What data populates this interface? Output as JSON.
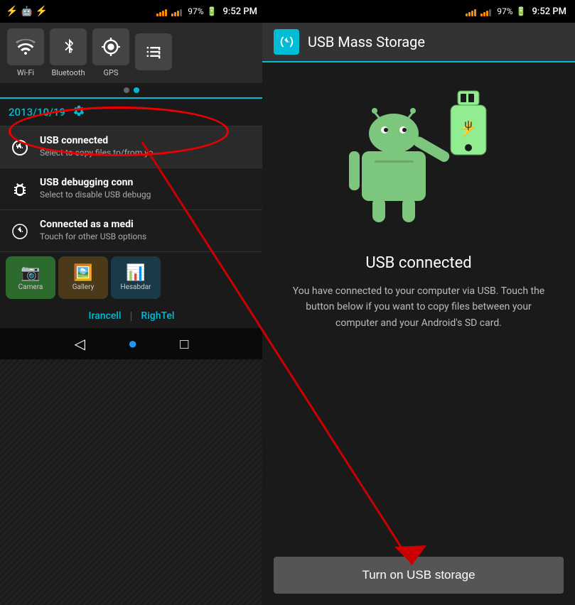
{
  "leftPanel": {
    "statusBar": {
      "usbIcon": "⚡",
      "batteryPercent": "97%",
      "time": "9:52 PM"
    },
    "quickToggles": [
      {
        "label": "Wi-Fi",
        "icon": "wifi",
        "active": false
      },
      {
        "label": "Bluetooth",
        "icon": "bt",
        "active": false
      },
      {
        "label": "GPS",
        "icon": "gps",
        "active": false
      },
      {
        "label": "",
        "icon": "share",
        "active": false
      }
    ],
    "dateText": "2013/10/19",
    "notifications": [
      {
        "title": "USB connected",
        "subtitle": "Select to copy files to/from yo",
        "icon": "usb",
        "highlighted": true
      },
      {
        "title": "USB debugging conn",
        "subtitle": "Select to disable USB debugg",
        "icon": "bug",
        "highlighted": false
      },
      {
        "title": "Connected as a medi",
        "subtitle": "Touch for other USB options",
        "icon": "usb",
        "highlighted": false
      }
    ],
    "apps": [
      {
        "label": "Camera"
      },
      {
        "label": "Gallery"
      },
      {
        "label": "Hesabdar"
      }
    ],
    "carriers": [
      "Irancell",
      "RighTel"
    ],
    "navButtons": [
      "◁",
      "○",
      "□"
    ]
  },
  "rightPanel": {
    "statusBar": {
      "batteryPercent": "97%",
      "time": "9:52 PM"
    },
    "header": {
      "title": "USB Mass Storage",
      "iconAlt": "usb-settings"
    },
    "content": {
      "title": "USB connected",
      "description": "You have connected to your computer via USB. Touch the button below if you want to copy files between your computer and your Android's SD card.",
      "buttonLabel": "Turn on USB storage"
    }
  }
}
